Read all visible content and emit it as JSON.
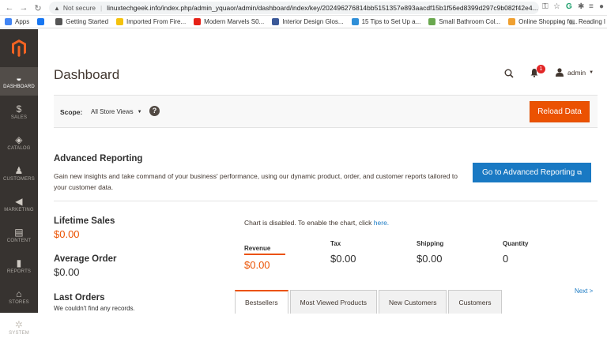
{
  "browser": {
    "security": "Not secure",
    "url": "linuxtechgeek.info/index.php/admin_yquaor/admin/dashboard/index/key/202496276814bb5151357e893aacdf15b1f56ed8399d297c9b082f42e4...",
    "bookmarks": [
      {
        "label": "Apps",
        "color": "#4285f4"
      },
      {
        "label": "",
        "color": "#1877f2"
      },
      {
        "label": "Getting Started",
        "color": "#555555"
      },
      {
        "label": "Imported From Fire...",
        "color": "#f4c20d"
      },
      {
        "label": "Modern Marvels S0...",
        "color": "#e62117"
      },
      {
        "label": "Interior Design Glos...",
        "color": "#3b5998"
      },
      {
        "label": "15 Tips to Set Up a...",
        "color": "#2f8fd8"
      },
      {
        "label": "Small Bathroom Col...",
        "color": "#6aa84f"
      },
      {
        "label": "Online Shopping fo...",
        "color": "#f0a030"
      }
    ],
    "reading_list": "Reading l"
  },
  "sidebar": {
    "items": [
      {
        "label": "DASHBOARD",
        "icon": "dashboard-icon",
        "glyph": "◒",
        "active": true
      },
      {
        "label": "SALES",
        "icon": "sales-icon",
        "glyph": "$",
        "active": false
      },
      {
        "label": "CATALOG",
        "icon": "catalog-icon",
        "glyph": "◈",
        "active": false
      },
      {
        "label": "CUSTOMERS",
        "icon": "customers-icon",
        "glyph": "♟",
        "active": false
      },
      {
        "label": "MARKETING",
        "icon": "marketing-icon",
        "glyph": "◀",
        "active": false
      },
      {
        "label": "CONTENT",
        "icon": "content-icon",
        "glyph": "▤",
        "active": false
      },
      {
        "label": "REPORTS",
        "icon": "reports-icon",
        "glyph": "▮",
        "active": false
      },
      {
        "label": "STORES",
        "icon": "stores-icon",
        "glyph": "⌂",
        "active": false
      },
      {
        "label": "SYSTEM",
        "icon": "system-icon",
        "glyph": "✲",
        "active": false
      }
    ]
  },
  "header": {
    "title": "Dashboard",
    "notifications_count": "1",
    "user": "admin"
  },
  "scope": {
    "label": "Scope:",
    "value": "All Store Views",
    "help": "?",
    "reload_label": "Reload Data"
  },
  "advanced": {
    "title": "Advanced Reporting",
    "description": "Gain new insights and take command of your business' performance, using our dynamic product, order, and customer reports tailored to your customer data.",
    "button_label": "Go to Advanced Reporting"
  },
  "stats": {
    "lifetime_label": "Lifetime Sales",
    "lifetime_value": "$0.00",
    "average_label": "Average Order",
    "average_value": "$0.00",
    "last_orders_label": "Last Orders",
    "last_orders_text": "We couldn't find any records."
  },
  "chart": {
    "message": "Chart is disabled. To enable the chart, click ",
    "link": "here."
  },
  "totals": {
    "revenue_label": "Revenue",
    "revenue_value": "$0.00",
    "tax_label": "Tax",
    "tax_value": "$0.00",
    "shipping_label": "Shipping",
    "shipping_value": "$0.00",
    "quantity_label": "Quantity",
    "quantity_value": "0"
  },
  "tabs": {
    "next": "Next >",
    "items": [
      "Bestsellers",
      "Most Viewed Products",
      "New Customers",
      "Customers"
    ]
  },
  "colors": {
    "accent": "#eb5202",
    "sidebar": "#373330",
    "primary_button": "#1979c3"
  }
}
